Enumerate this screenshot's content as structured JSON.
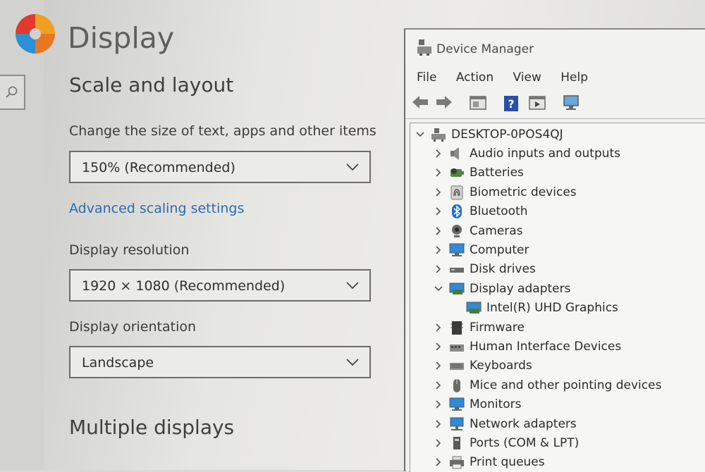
{
  "settings": {
    "page_title": "Display",
    "scale_section_title": "Scale and layout",
    "scale_label": "Change the size of text, apps and other items",
    "scale_value": "150% (Recommended)",
    "advanced_link": "Advanced scaling settings",
    "resolution_label": "Display resolution",
    "resolution_value": "1920 × 1080 (Recommended)",
    "orientation_label": "Display orientation",
    "orientation_value": "Landscape",
    "multiple_displays_title": "Multiple displays"
  },
  "device_manager": {
    "title": "Device Manager",
    "menu": [
      "File",
      "Action",
      "View",
      "Help"
    ],
    "toolbar_icons": [
      "back-arrow-icon",
      "forward-arrow-icon",
      "properties-icon",
      "help-icon",
      "update-driver-icon",
      "scan-hardware-icon"
    ],
    "root": "DESKTOP-0POS4QJ",
    "items": [
      {
        "label": "Audio inputs and outputs",
        "icon": "speaker-icon",
        "expanded": false
      },
      {
        "label": "Batteries",
        "icon": "battery-icon",
        "expanded": false
      },
      {
        "label": "Biometric devices",
        "icon": "fingerprint-icon",
        "expanded": false
      },
      {
        "label": "Bluetooth",
        "icon": "bluetooth-icon",
        "expanded": false
      },
      {
        "label": "Cameras",
        "icon": "camera-icon",
        "expanded": false
      },
      {
        "label": "Computer",
        "icon": "computer-icon",
        "expanded": false
      },
      {
        "label": "Disk drives",
        "icon": "disk-drive-icon",
        "expanded": false
      },
      {
        "label": "Display adapters",
        "icon": "display-adapter-icon",
        "expanded": true
      },
      {
        "label": "Intel(R) UHD Graphics",
        "icon": "display-adapter-icon",
        "child": true
      },
      {
        "label": "Firmware",
        "icon": "firmware-icon",
        "expanded": false
      },
      {
        "label": "Human Interface Devices",
        "icon": "hid-icon",
        "expanded": false
      },
      {
        "label": "Keyboards",
        "icon": "keyboard-icon",
        "expanded": false
      },
      {
        "label": "Mice and other pointing devices",
        "icon": "mouse-icon",
        "expanded": false
      },
      {
        "label": "Monitors",
        "icon": "monitor-icon",
        "expanded": false
      },
      {
        "label": "Network adapters",
        "icon": "network-icon",
        "expanded": false
      },
      {
        "label": "Ports (COM & LPT)",
        "icon": "port-icon",
        "expanded": false
      },
      {
        "label": "Print queues",
        "icon": "printer-icon",
        "expanded": false
      }
    ]
  },
  "colors": {
    "accent_link": "#2c6cae",
    "bluetooth": "#1f6fd6",
    "monitor_blue": "#2f8ad8"
  }
}
